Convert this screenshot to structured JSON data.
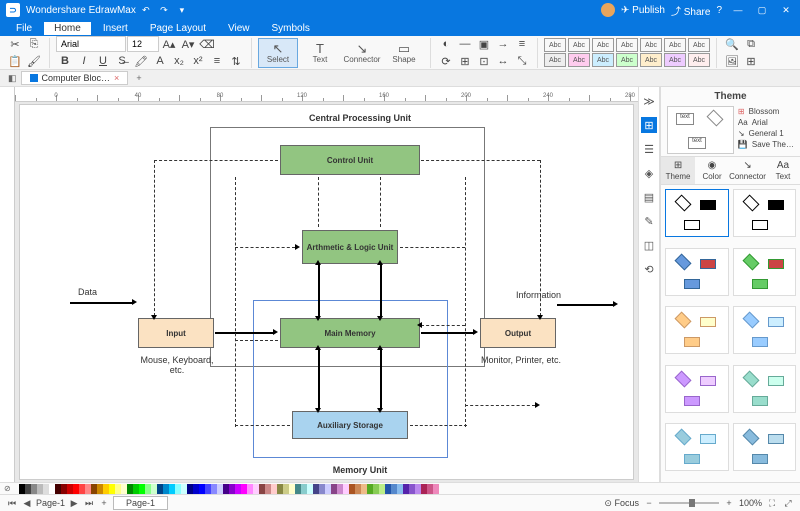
{
  "app": {
    "title": "Wondershare EdrawMax"
  },
  "titlebtns": {
    "publish": "Publish",
    "share": "Share"
  },
  "menu": {
    "file": "File",
    "home": "Home",
    "insert": "Insert",
    "page_layout": "Page Layout",
    "view": "View",
    "symbols": "Symbols"
  },
  "toolbar": {
    "font": "Arial",
    "size": "12",
    "select": "Select",
    "text": "Text",
    "connector": "Connector",
    "shape": "Shape",
    "abc": "Abc"
  },
  "doc_tab": {
    "name": "Computer Bloc…"
  },
  "diagram": {
    "cpu_title": "Central Processing Unit",
    "control_unit": "Control Unit",
    "alu": "Arthmetic & Logic Unit",
    "main_memory": "Main Memory",
    "aux_storage": "Auxiliary Storage",
    "memory_unit": "Memory Unit",
    "input": "Input",
    "output": "Output",
    "data": "Data",
    "information": "Information",
    "input_sub": "Mouse, Keyboard, etc.",
    "output_sub": "Monitor, Printer, etc."
  },
  "right": {
    "title": "Theme",
    "blossom": "Blossom",
    "arial": "Arial",
    "general": "General 1",
    "save": "Save The…",
    "tabs": {
      "theme": "Theme",
      "color": "Color",
      "connector": "Connector",
      "text": "Text"
    },
    "preview_text": "text"
  },
  "status": {
    "page": "Page-1",
    "focus": "Focus",
    "zoom": "100%"
  }
}
